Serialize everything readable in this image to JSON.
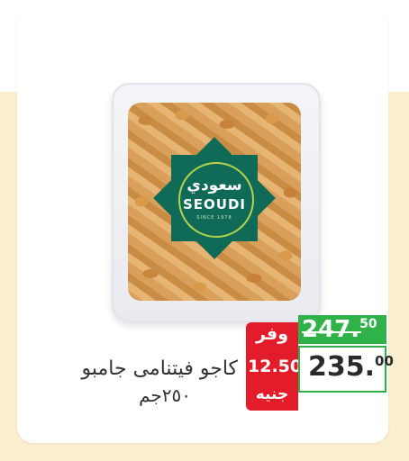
{
  "brand": {
    "arabic": "سعودي",
    "latin": "SEOUDI",
    "tagline": "SINCE 1978"
  },
  "product": {
    "name": "كاجو فيتنامى جامبو",
    "weight": "٢٥٠جم"
  },
  "price": {
    "save_label": "وفر",
    "save_amount": "12.50",
    "currency": "جنيه",
    "old_int": "247.",
    "old_dec": "50",
    "new_int": "235.",
    "new_dec": "00"
  },
  "colors": {
    "save_red": "#e21c2a",
    "accent_green": "#2fb24a",
    "brand_green": "#0f6b57",
    "background_cream": "#fbefcf"
  }
}
